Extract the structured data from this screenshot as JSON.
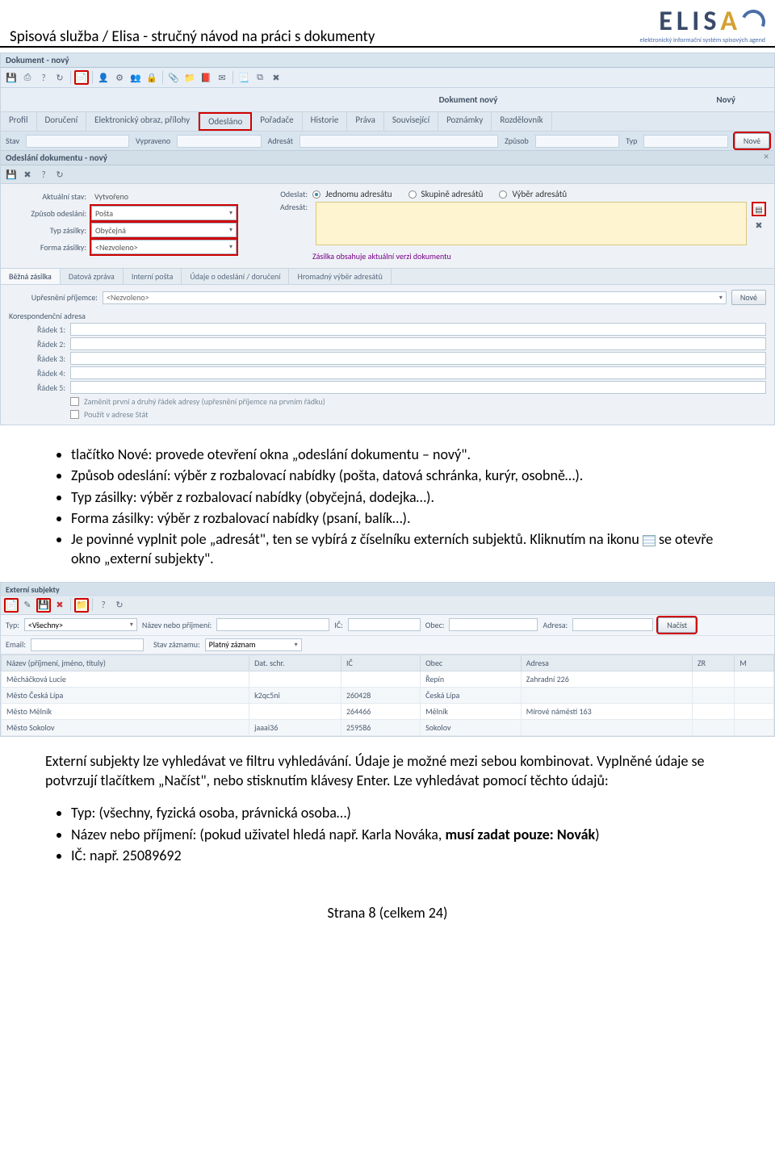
{
  "header": {
    "title": "Spisová služba / Elisa - stručný návod na práci s dokumenty",
    "logo_main": "ELISA",
    "logo_sub": "elektronický informační systém spisových agend"
  },
  "shot1": {
    "win_title": "Dokument - nový",
    "doc_label_mid": "Dokument nový",
    "doc_label_right": "Nový",
    "tabs": [
      "Profil",
      "Doručení",
      "Elektronický obraz, přílohy",
      "Odesláno",
      "Pořadače",
      "Historie",
      "Práva",
      "Související",
      "Poznámky",
      "Rozdělovník"
    ],
    "subbar": {
      "stav": "Stav",
      "vypraveno": "Vypraveno",
      "adresat": "Adresát",
      "zpusob": "Způsob",
      "typ": "Typ",
      "nove": "Nové"
    },
    "panel_title": "Odeslání dokumentu - nový",
    "rows": {
      "aktualni_stav_label": "Aktuální stav:",
      "aktualni_stav_value": "Vytvořeno",
      "zpusob_odeslani_label": "Způsob odeslání:",
      "zpusob_odeslani_value": "Pošta",
      "typ_zasilky_label": "Typ zásilky:",
      "typ_zasilky_value": "Obyčejná",
      "forma_zasilky_label": "Forma zásilky:",
      "forma_zasilky_value": "<Nezvoleno>",
      "odeslat_label": "Odeslat:",
      "radio1": "Jednomu adresátu",
      "radio2": "Skupině adresátů",
      "radio3": "Výběr adresátů",
      "adresat_label": "Adresát:",
      "note": "Zásilka obsahuje aktuální verzi dokumentu"
    },
    "sub_tabs": [
      "Běžná zásilka",
      "Datová zpráva",
      "Interní pošta",
      "Údaje o odeslání / doručení",
      "Hromadný výběr adresátů"
    ],
    "upresneni": {
      "label": "Upřesnění příjemce:",
      "value": "<Nezvoleno>",
      "nove": "Nové"
    },
    "addr_section": "Korespondenční adresa",
    "addr_labels": [
      "Řádek 1:",
      "Řádek 2:",
      "Řádek 3:",
      "Řádek 4:",
      "Řádek 5:"
    ],
    "chk1": "Zaměnit první a druhý řádek adresy (upřesnění příjemce na prvním řádku)",
    "chk2": "Použít v adrese Stát"
  },
  "bullets1": [
    "tlačítko Nové: provede otevření okna „odeslání dokumentu – nový\".",
    "Způsob odeslání: výběr z rozbalovací nabídky (pošta, datová schránka, kurýr, osobně…).",
    "Typ zásilky: výběr z rozbalovací nabídky (obyčejná, dodejka…).",
    "Forma zásilky: výběr z rozbalovací nabídky (psaní, balík…).",
    "Je povinné vyplnit pole „adresát\", ten se vybírá z číselníku externích subjektů. Kliknutím na ikonu __ICON__ se otevře okno „externí subjekty\"."
  ],
  "shot2": {
    "hdr": "Externí subjekty",
    "filter": {
      "typ_label": "Typ:",
      "typ_value": "<Všechny>",
      "nazev_label": "Název nebo příjmení:",
      "ic_label": "IČ:",
      "obec_label": "Obec:",
      "adresa_label": "Adresa:",
      "nacist": "Načíst",
      "email_label": "Email:",
      "stav_label": "Stav záznamu:",
      "stav_value": "Platný záznam"
    },
    "cols": [
      "Název (příjmení, jméno, tituly)",
      "Dat. schr.",
      "IČ",
      "Obec",
      "Adresa",
      "ZR",
      "M"
    ],
    "rows": [
      [
        "Měcháčková Lucie",
        "",
        "",
        "Řepín",
        "Zahradní  226",
        "",
        ""
      ],
      [
        "Město Česká Lípa",
        "k2qc5ni",
        "260428",
        "Česká Lípa",
        "",
        "",
        ""
      ],
      [
        "Město Mělník",
        "",
        "264466",
        "Mělník",
        "Mírové náměstí  163",
        "",
        ""
      ],
      [
        "Město Sokolov",
        "jaaai36",
        "259586",
        "Sokolov",
        "",
        "",
        ""
      ]
    ]
  },
  "para2": "Externí subjekty lze vyhledávat ve filtru vyhledávání. Údaje je možné mezi sebou kombinovat. Vyplněné údaje se potvrzují tlačítkem „Načíst\", nebo stisknutím klávesy Enter. Lze vyhledávat pomocí těchto údajů:",
  "bullets2": {
    "item1": "Typ: (všechny, fyzická osoba, právnická osoba…)",
    "item2_pre": "Název nebo příjmení: (pokud uživatel hledá např. Karla Nováka, ",
    "item2_bold": "musí zadat pouze: Novák",
    "item2_post": ")",
    "item3": "IČ: např. 25089692"
  },
  "footer": "Strana 8 (celkem 24)"
}
